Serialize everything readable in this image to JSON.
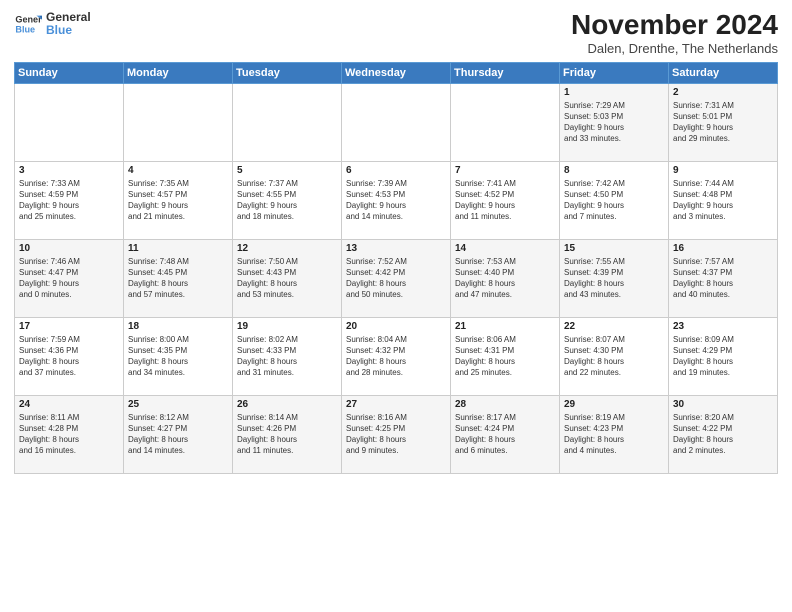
{
  "logo": {
    "line1": "General",
    "line2": "Blue"
  },
  "title": "November 2024",
  "subtitle": "Dalen, Drenthe, The Netherlands",
  "weekdays": [
    "Sunday",
    "Monday",
    "Tuesday",
    "Wednesday",
    "Thursday",
    "Friday",
    "Saturday"
  ],
  "weeks": [
    [
      {
        "day": "",
        "info": ""
      },
      {
        "day": "",
        "info": ""
      },
      {
        "day": "",
        "info": ""
      },
      {
        "day": "",
        "info": ""
      },
      {
        "day": "",
        "info": ""
      },
      {
        "day": "1",
        "info": "Sunrise: 7:29 AM\nSunset: 5:03 PM\nDaylight: 9 hours\nand 33 minutes."
      },
      {
        "day": "2",
        "info": "Sunrise: 7:31 AM\nSunset: 5:01 PM\nDaylight: 9 hours\nand 29 minutes."
      }
    ],
    [
      {
        "day": "3",
        "info": "Sunrise: 7:33 AM\nSunset: 4:59 PM\nDaylight: 9 hours\nand 25 minutes."
      },
      {
        "day": "4",
        "info": "Sunrise: 7:35 AM\nSunset: 4:57 PM\nDaylight: 9 hours\nand 21 minutes."
      },
      {
        "day": "5",
        "info": "Sunrise: 7:37 AM\nSunset: 4:55 PM\nDaylight: 9 hours\nand 18 minutes."
      },
      {
        "day": "6",
        "info": "Sunrise: 7:39 AM\nSunset: 4:53 PM\nDaylight: 9 hours\nand 14 minutes."
      },
      {
        "day": "7",
        "info": "Sunrise: 7:41 AM\nSunset: 4:52 PM\nDaylight: 9 hours\nand 11 minutes."
      },
      {
        "day": "8",
        "info": "Sunrise: 7:42 AM\nSunset: 4:50 PM\nDaylight: 9 hours\nand 7 minutes."
      },
      {
        "day": "9",
        "info": "Sunrise: 7:44 AM\nSunset: 4:48 PM\nDaylight: 9 hours\nand 3 minutes."
      }
    ],
    [
      {
        "day": "10",
        "info": "Sunrise: 7:46 AM\nSunset: 4:47 PM\nDaylight: 9 hours\nand 0 minutes."
      },
      {
        "day": "11",
        "info": "Sunrise: 7:48 AM\nSunset: 4:45 PM\nDaylight: 8 hours\nand 57 minutes."
      },
      {
        "day": "12",
        "info": "Sunrise: 7:50 AM\nSunset: 4:43 PM\nDaylight: 8 hours\nand 53 minutes."
      },
      {
        "day": "13",
        "info": "Sunrise: 7:52 AM\nSunset: 4:42 PM\nDaylight: 8 hours\nand 50 minutes."
      },
      {
        "day": "14",
        "info": "Sunrise: 7:53 AM\nSunset: 4:40 PM\nDaylight: 8 hours\nand 47 minutes."
      },
      {
        "day": "15",
        "info": "Sunrise: 7:55 AM\nSunset: 4:39 PM\nDaylight: 8 hours\nand 43 minutes."
      },
      {
        "day": "16",
        "info": "Sunrise: 7:57 AM\nSunset: 4:37 PM\nDaylight: 8 hours\nand 40 minutes."
      }
    ],
    [
      {
        "day": "17",
        "info": "Sunrise: 7:59 AM\nSunset: 4:36 PM\nDaylight: 8 hours\nand 37 minutes."
      },
      {
        "day": "18",
        "info": "Sunrise: 8:00 AM\nSunset: 4:35 PM\nDaylight: 8 hours\nand 34 minutes."
      },
      {
        "day": "19",
        "info": "Sunrise: 8:02 AM\nSunset: 4:33 PM\nDaylight: 8 hours\nand 31 minutes."
      },
      {
        "day": "20",
        "info": "Sunrise: 8:04 AM\nSunset: 4:32 PM\nDaylight: 8 hours\nand 28 minutes."
      },
      {
        "day": "21",
        "info": "Sunrise: 8:06 AM\nSunset: 4:31 PM\nDaylight: 8 hours\nand 25 minutes."
      },
      {
        "day": "22",
        "info": "Sunrise: 8:07 AM\nSunset: 4:30 PM\nDaylight: 8 hours\nand 22 minutes."
      },
      {
        "day": "23",
        "info": "Sunrise: 8:09 AM\nSunset: 4:29 PM\nDaylight: 8 hours\nand 19 minutes."
      }
    ],
    [
      {
        "day": "24",
        "info": "Sunrise: 8:11 AM\nSunset: 4:28 PM\nDaylight: 8 hours\nand 16 minutes."
      },
      {
        "day": "25",
        "info": "Sunrise: 8:12 AM\nSunset: 4:27 PM\nDaylight: 8 hours\nand 14 minutes."
      },
      {
        "day": "26",
        "info": "Sunrise: 8:14 AM\nSunset: 4:26 PM\nDaylight: 8 hours\nand 11 minutes."
      },
      {
        "day": "27",
        "info": "Sunrise: 8:16 AM\nSunset: 4:25 PM\nDaylight: 8 hours\nand 9 minutes."
      },
      {
        "day": "28",
        "info": "Sunrise: 8:17 AM\nSunset: 4:24 PM\nDaylight: 8 hours\nand 6 minutes."
      },
      {
        "day": "29",
        "info": "Sunrise: 8:19 AM\nSunset: 4:23 PM\nDaylight: 8 hours\nand 4 minutes."
      },
      {
        "day": "30",
        "info": "Sunrise: 8:20 AM\nSunset: 4:22 PM\nDaylight: 8 hours\nand 2 minutes."
      }
    ]
  ]
}
